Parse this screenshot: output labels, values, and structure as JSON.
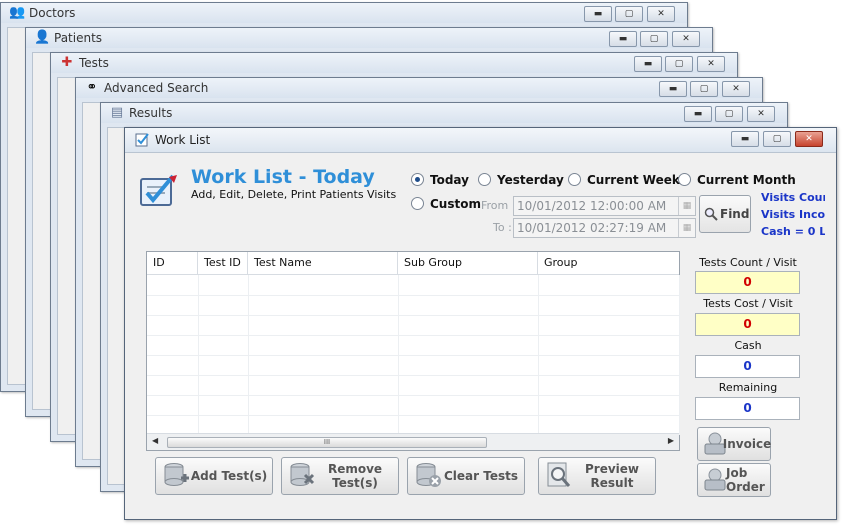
{
  "background_windows": [
    {
      "title": "Doctors",
      "icon": "doctors-icon"
    },
    {
      "title": "Patients",
      "icon": "patients-icon"
    },
    {
      "title": "Tests",
      "icon": "tests-icon"
    },
    {
      "title": "Advanced Search",
      "icon": "binoculars-icon"
    },
    {
      "title": "Results",
      "icon": "document-icon"
    }
  ],
  "window": {
    "title": "Work List",
    "controls": {
      "minimize": "▬",
      "maximize": "▢",
      "close": "✕"
    }
  },
  "header": {
    "title": "Work List - Today",
    "subtitle": "Add, Edit, Delete, Print Patients Visits"
  },
  "filters": {
    "selected": "Today",
    "options": [
      "Today",
      "Yesterday",
      "Current Week",
      "Current Month",
      "Custom"
    ],
    "from_label": "From :",
    "to_label": "To :",
    "from_value": "10/01/2012 12:00:00 AM",
    "to_value": "10/01/2012 02:27:19 AM",
    "find_label": "Find"
  },
  "visit_info": [
    "Visits Count",
    "Visits Incom",
    "Cash = 0 L."
  ],
  "grid": {
    "columns": [
      "ID",
      "Test ID",
      "Test Name",
      "Sub Group",
      "Group"
    ],
    "rows": [],
    "scroll_grip": "III"
  },
  "stats": {
    "tests_count_label": "Tests Count / Visit",
    "tests_count_value": "0",
    "tests_cost_label": "Tests Cost / Visit",
    "tests_cost_value": "0",
    "cash_label": "Cash",
    "cash_value": "0",
    "remaining_label": "Remaining",
    "remaining_value": "0"
  },
  "buttons": {
    "add_tests": "Add Test(s)",
    "remove_tests": "Remove Test(s)",
    "clear_tests": "Clear Tests",
    "preview_result": "Preview Result",
    "invoice": "Invoice",
    "job_order": "Job Order"
  },
  "colors": {
    "title_blue": "#2f8fd8",
    "info_blue": "#1a35c8",
    "value_red": "#d10000",
    "highlight_yellow": "#ffffc6"
  }
}
